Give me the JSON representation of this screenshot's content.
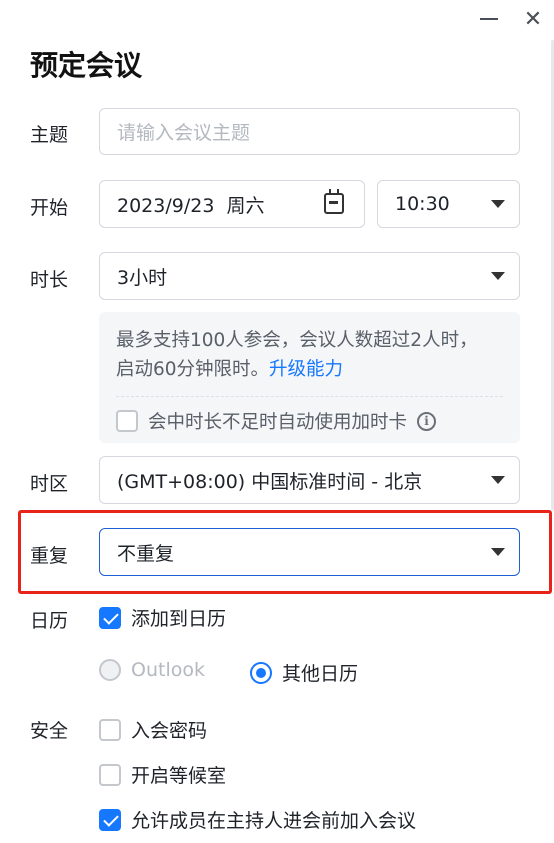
{
  "window": {
    "title": "预定会议"
  },
  "subject": {
    "label": "主题",
    "placeholder": "请输入会议主题"
  },
  "start": {
    "label": "开始",
    "date": "2023/9/23  周六",
    "time": "10:30"
  },
  "duration": {
    "label": "时长",
    "value": "3小时",
    "notice_text": "最多支持100人参会，会议人数超过2人时，启动60分钟限时。",
    "upgrade_link": "升级能力",
    "auto_extend_label": "会中时长不足时自动使用加时卡",
    "auto_extend_checked": false
  },
  "timezone": {
    "label": "时区",
    "value": "(GMT+08:00) 中国标准时间 - 北京"
  },
  "repeat": {
    "label": "重复",
    "value": "不重复"
  },
  "calendar": {
    "label": "日历",
    "add_label": "添加到日历",
    "add_checked": true,
    "options": [
      {
        "label": "Outlook",
        "selected": false,
        "disabled": true
      },
      {
        "label": "其他日历",
        "selected": true,
        "disabled": false
      }
    ]
  },
  "security": {
    "label": "安全",
    "options": [
      {
        "label": "入会密码",
        "checked": false
      },
      {
        "label": "开启等候室",
        "checked": false
      },
      {
        "label": "允许成员在主持人进会前加入会议",
        "checked": true
      }
    ]
  },
  "colors": {
    "accent": "#1677ff",
    "highlight": "#e8231a"
  }
}
